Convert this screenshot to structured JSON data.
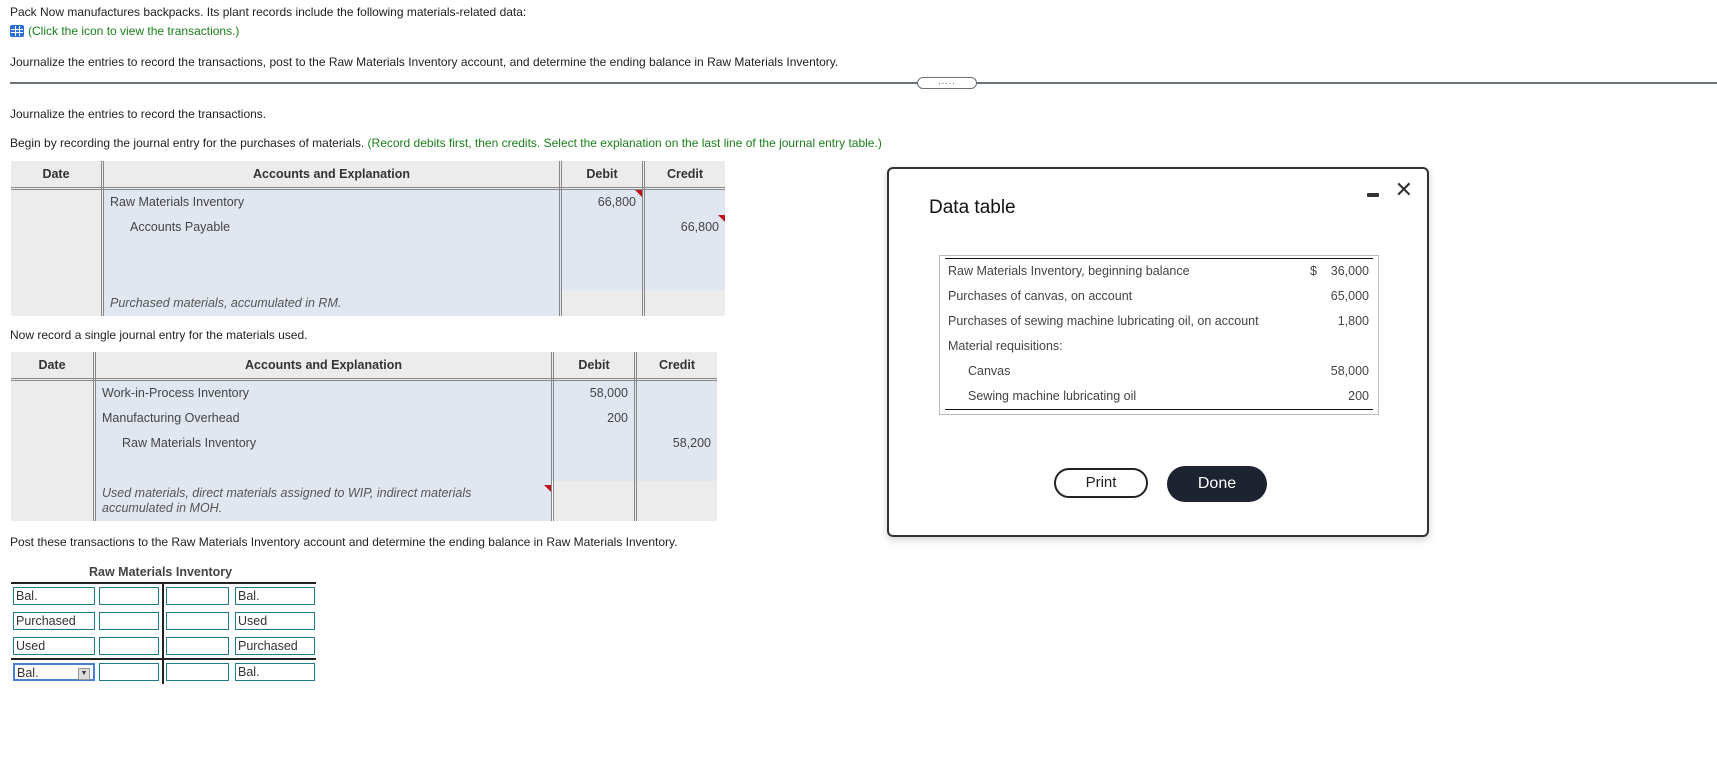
{
  "intro": {
    "problem_text": "Pack Now manufactures backpacks. Its plant records include the following materials-related data:",
    "icon_link": "(Click the icon to view the transactions.)",
    "instruction": "Journalize the entries to record the transactions, post to the Raw Materials Inventory account, and determine the ending balance in Raw Materials Inventory.",
    "handle_dots": "....."
  },
  "part1": {
    "heading": "Journalize the entries to record the transactions.",
    "prompt": "Begin by recording the journal entry for the purchases of materials.",
    "hint": "(Record debits first, then credits. Select the explanation on the last line of the journal entry table.)"
  },
  "journal_headers": {
    "date": "Date",
    "accounts": "Accounts and Explanation",
    "debit": "Debit",
    "credit": "Credit"
  },
  "journal1": {
    "rows": [
      {
        "account": "Raw Materials Inventory",
        "debit": "66,800",
        "credit": ""
      },
      {
        "account": "Accounts Payable",
        "debit": "",
        "credit": "66,800"
      }
    ],
    "explanation": "Purchased materials, accumulated in RM."
  },
  "part2": {
    "prompt": "Now record a single journal entry for the materials used."
  },
  "journal2": {
    "rows": [
      {
        "account": "Work-in-Process Inventory",
        "debit": "58,000",
        "credit": ""
      },
      {
        "account": "Manufacturing Overhead",
        "debit": "200",
        "credit": ""
      },
      {
        "account": "Raw Materials Inventory",
        "debit": "",
        "credit": "58,200"
      }
    ],
    "explanation": "Used materials, direct materials assigned to WIP, indirect materials accumulated in MOH."
  },
  "part3": {
    "prompt": "Post these transactions to the Raw Materials Inventory account and determine the ending balance in Raw Materials Inventory."
  },
  "t_account": {
    "title": "Raw Materials Inventory",
    "left_labels": [
      "Bal.",
      "Purchased",
      "Used",
      "Bal."
    ],
    "right_labels": [
      "Bal.",
      "Used",
      "Purchased",
      "Bal."
    ],
    "left_values": [
      "",
      "",
      "",
      ""
    ],
    "right_values": [
      "",
      "",
      "",
      ""
    ]
  },
  "modal": {
    "title": "Data table",
    "rows": [
      {
        "label": "Raw Materials Inventory, beginning balance",
        "currency": "$",
        "value": "36,000"
      },
      {
        "label": "Purchases of canvas, on account",
        "currency": "",
        "value": "65,000"
      },
      {
        "label": "Purchases of sewing machine lubricating oil, on account",
        "currency": "",
        "value": "1,800"
      },
      {
        "label": "Material requisitions:",
        "currency": "",
        "value": ""
      },
      {
        "label": "Canvas",
        "currency": "",
        "value": "58,000"
      },
      {
        "label": "Sewing machine lubricating oil",
        "currency": "",
        "value": "200"
      }
    ],
    "print_label": "Print",
    "done_label": "Done",
    "close_glyph": "✕"
  }
}
